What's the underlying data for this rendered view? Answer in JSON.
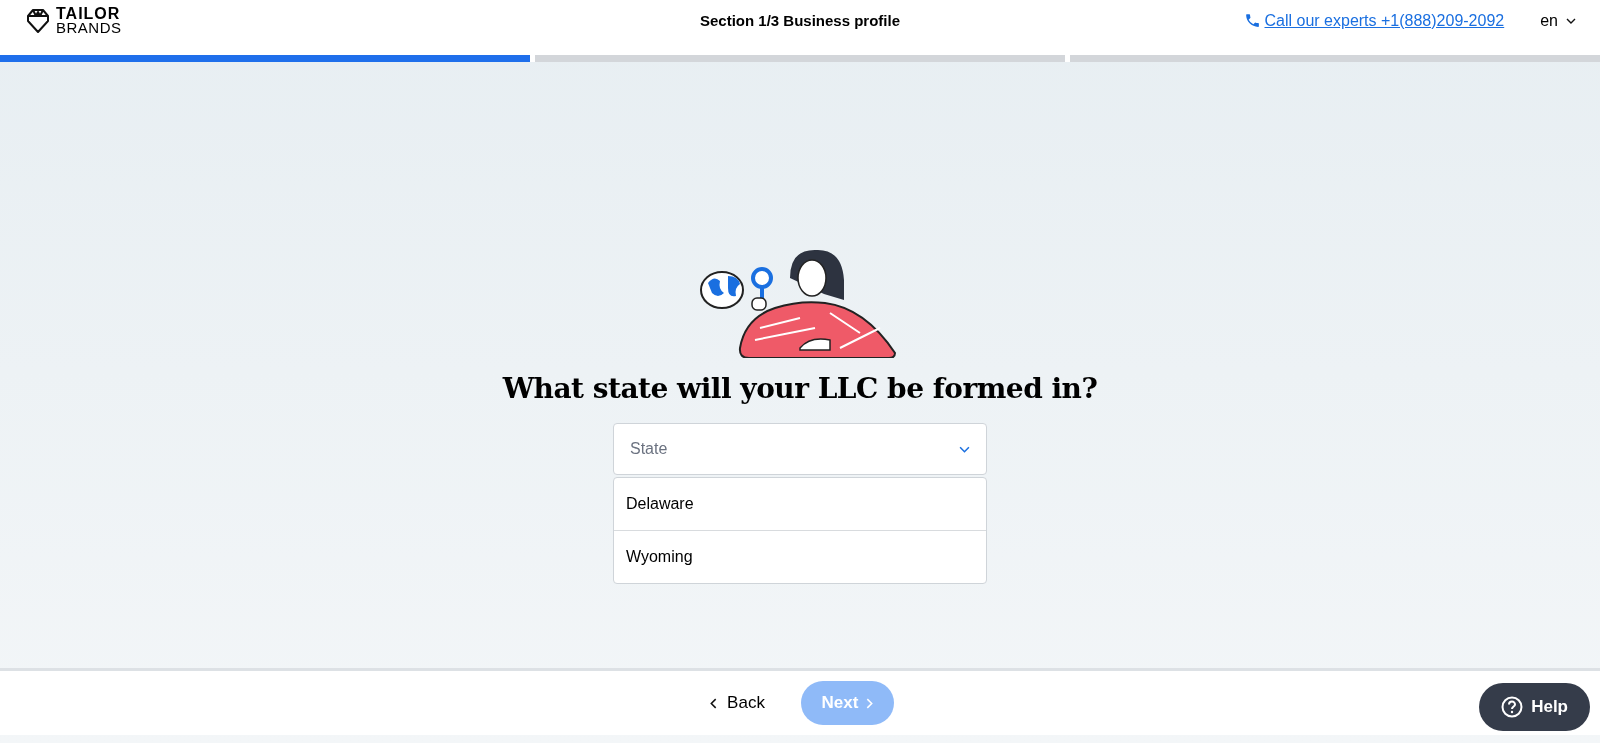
{
  "header": {
    "logo": {
      "line_1": "TAILOR",
      "line_2": "BRANDS"
    },
    "section_title": "Section 1/3 Business profile",
    "phone_link": "Call our experts +1(888)209-2092",
    "language": "en"
  },
  "progress": [
    {
      "complete": true
    },
    {
      "complete": false
    },
    {
      "complete": false
    }
  ],
  "question": "What state will your LLC be formed in?",
  "state_select": {
    "placeholder": "State",
    "expanded": true,
    "options": [
      {
        "label": "Delaware",
        "selected": false
      },
      {
        "label": "Wyoming",
        "selected": false
      }
    ]
  },
  "footer": {
    "back": "Back",
    "next": {
      "label": "Next",
      "disabled": true
    },
    "help": "Help"
  }
}
